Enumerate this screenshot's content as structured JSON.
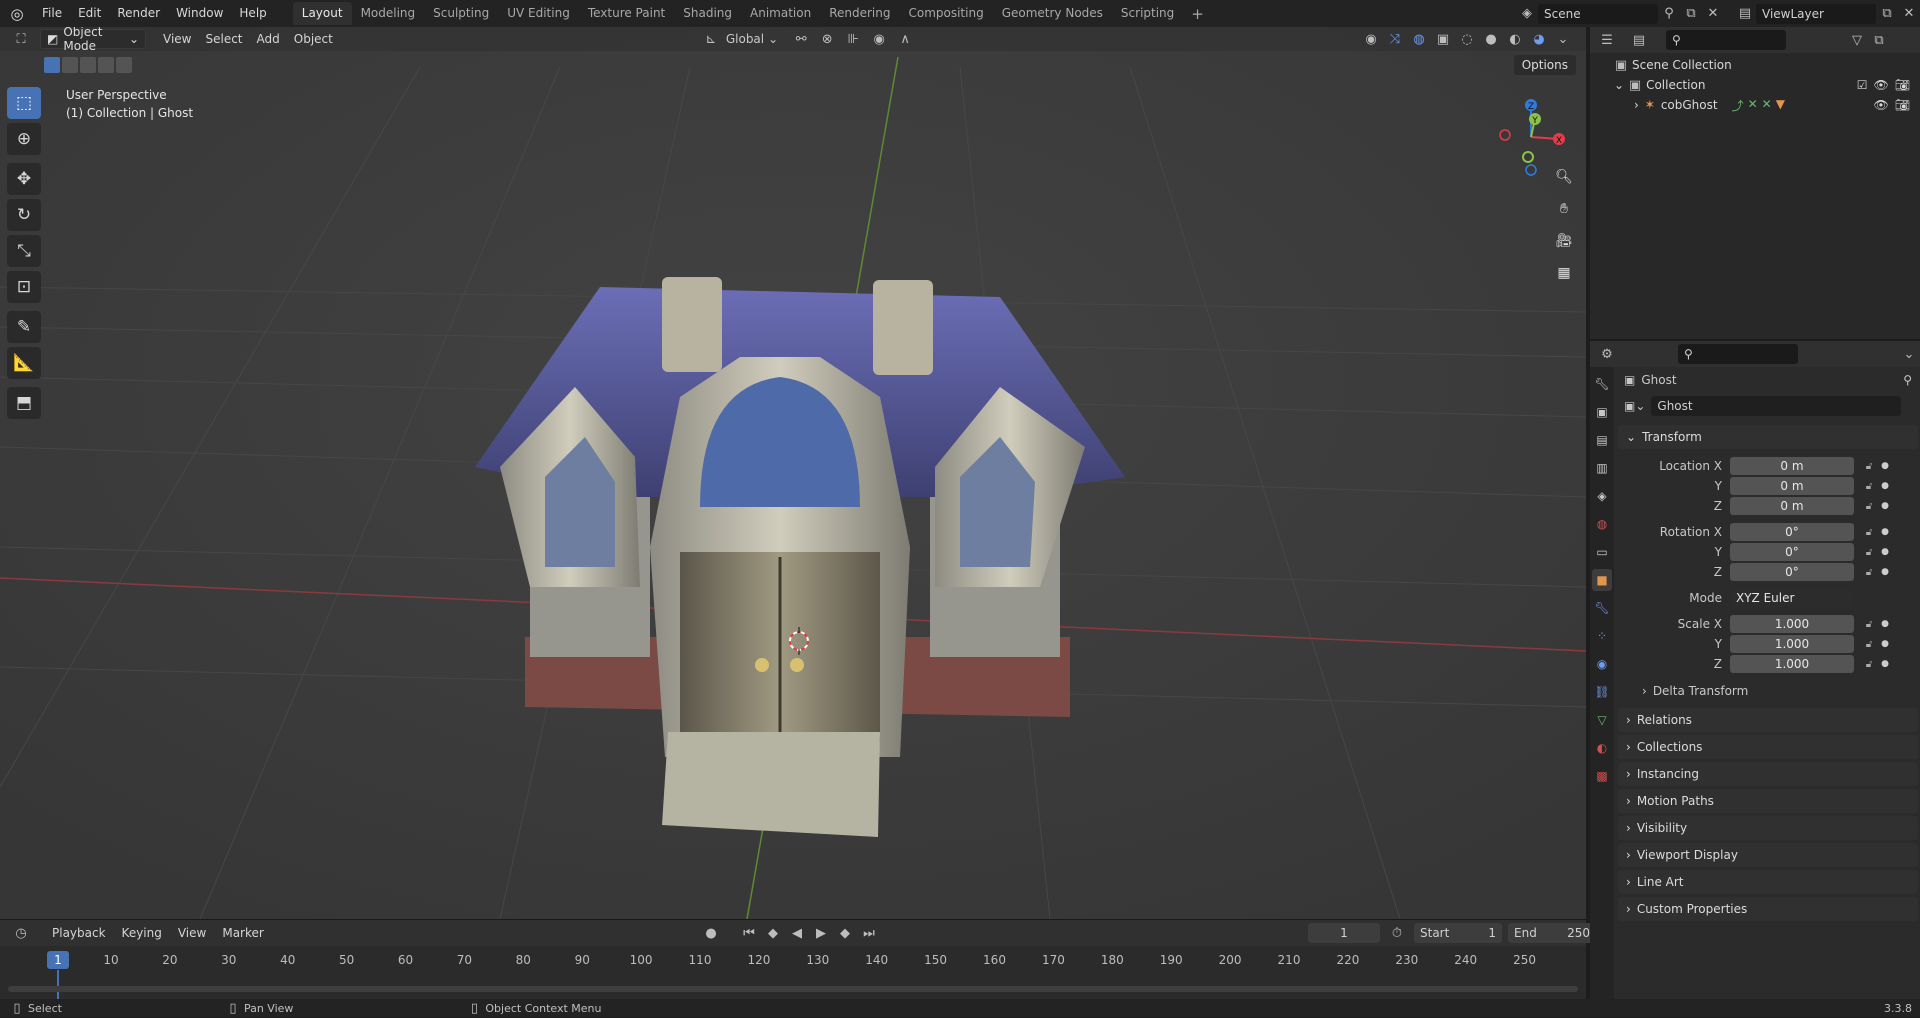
{
  "topbar": {
    "menus": [
      "File",
      "Edit",
      "Render",
      "Window",
      "Help"
    ],
    "workspaces": [
      "Layout",
      "Modeling",
      "Sculpting",
      "UV Editing",
      "Texture Paint",
      "Shading",
      "Animation",
      "Rendering",
      "Compositing",
      "Geometry Nodes",
      "Scripting"
    ],
    "active_workspace": "Layout",
    "scene": "Scene",
    "view_layer": "ViewLayer"
  },
  "viewport": {
    "mode": "Object Mode",
    "menus": [
      "View",
      "Select",
      "Add",
      "Object"
    ],
    "orientation": "Global",
    "info_line1": "User Perspective",
    "info_line2": "(1) Collection | Ghost",
    "options_label": "Options",
    "gizmo_axes": [
      "X",
      "Y",
      "Z"
    ]
  },
  "timeline": {
    "menus": [
      "Playback",
      "Keying",
      "View",
      "Marker"
    ],
    "current_frame": "1",
    "start_label": "Start",
    "start": "1",
    "end_label": "End",
    "end": "250",
    "ticks": [
      "1",
      "10",
      "20",
      "30",
      "40",
      "50",
      "60",
      "70",
      "80",
      "90",
      "100",
      "110",
      "120",
      "130",
      "140",
      "150",
      "160",
      "170",
      "180",
      "190",
      "200",
      "210",
      "220",
      "230",
      "240",
      "250"
    ]
  },
  "statusbar": {
    "select": "Select",
    "pan": "Pan View",
    "context": "Object Context Menu",
    "version": "3.3.8"
  },
  "outliner": {
    "scene_collection": "Scene Collection",
    "collection": "Collection",
    "object": "cobGhost"
  },
  "properties": {
    "object_name": "Ghost",
    "data_name": "Ghost",
    "transform": {
      "title": "Transform",
      "location_label": "Location X",
      "loc_x": "0 m",
      "loc_y": "0 m",
      "loc_z": "0 m",
      "rotation_label": "Rotation X",
      "rot_x": "0°",
      "rot_y": "0°",
      "rot_z": "0°",
      "mode_label": "Mode",
      "mode": "XYZ Euler",
      "scale_label": "Scale X",
      "scale_x": "1.000",
      "scale_y": "1.000",
      "scale_z": "1.000",
      "y_label": "Y",
      "z_label": "Z"
    },
    "delta_transform": "Delta Transform",
    "panels": [
      "Relations",
      "Collections",
      "Instancing",
      "Motion Paths",
      "Visibility",
      "Viewport Display",
      "Line Art",
      "Custom Properties"
    ]
  },
  "colors": {
    "accent": "#4772b3",
    "x_axis": "#e53b4a",
    "y_axis": "#8bc34a",
    "z_axis": "#2f7ce0",
    "roof": "#5b5d9c",
    "walls": "#a9a79a"
  }
}
